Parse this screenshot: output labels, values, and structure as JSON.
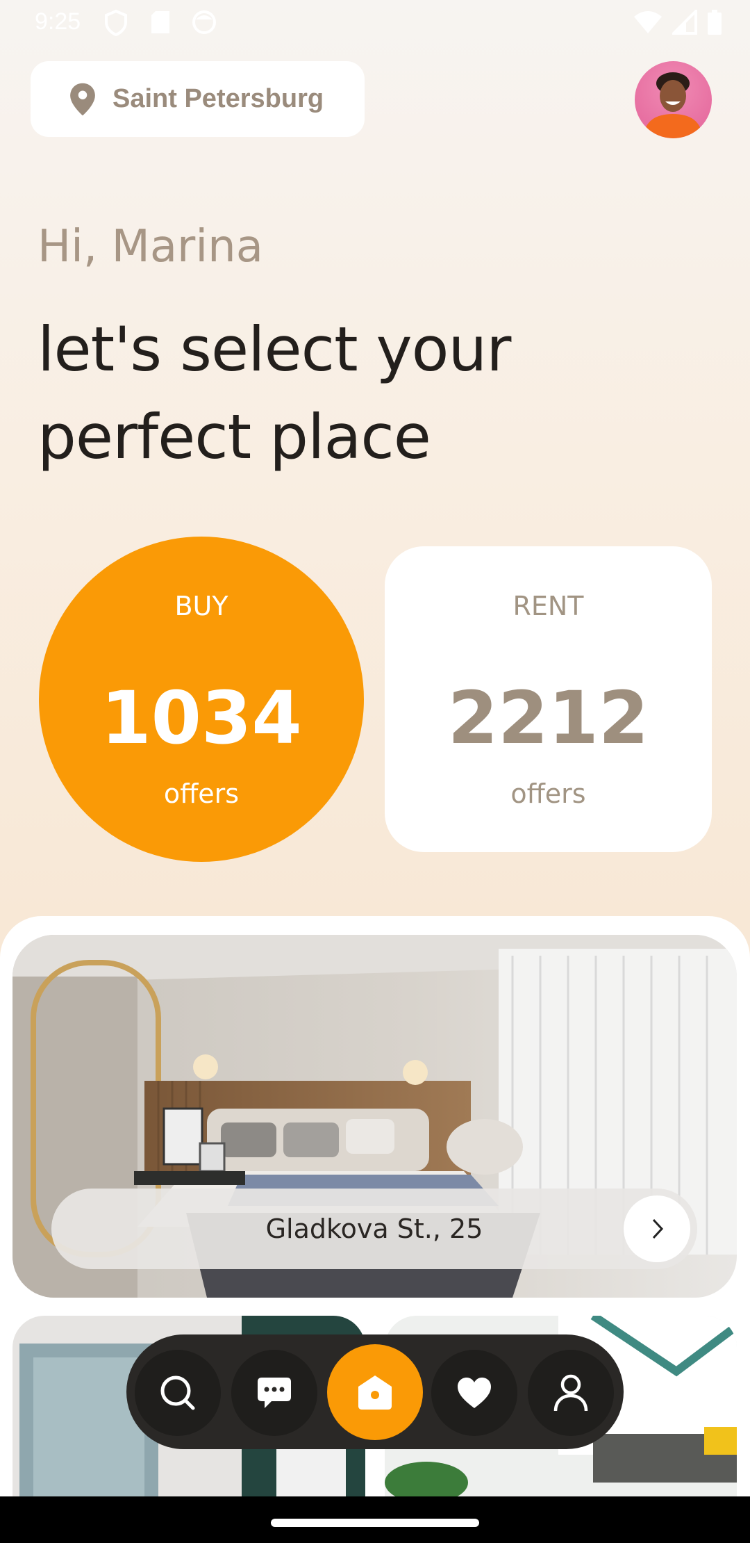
{
  "status_bar": {
    "time": "9:25",
    "left_icons": [
      "shield-icon",
      "sd-card-icon",
      "face-icon"
    ],
    "right_icons": [
      "wifi-icon",
      "signal-icon",
      "battery-icon"
    ]
  },
  "location": {
    "label": "Saint Petersburg",
    "icon": "map-pin-icon"
  },
  "user": {
    "avatar": "user-avatar"
  },
  "greeting": "Hi, Marina",
  "headline": "let's select your perfect place",
  "stats": {
    "buy": {
      "label": "BUY",
      "count": "1034",
      "unit": "offers"
    },
    "rent": {
      "label": "RENT",
      "count": "2212",
      "unit": "offers"
    }
  },
  "listings": {
    "featured": {
      "address": "Gladkova St., 25"
    }
  },
  "bottom_nav": {
    "items": [
      {
        "icon": "search-icon",
        "active": false
      },
      {
        "icon": "chat-icon",
        "active": false
      },
      {
        "icon": "home-icon",
        "active": true
      },
      {
        "icon": "heart-icon",
        "active": false
      },
      {
        "icon": "profile-icon",
        "active": false
      }
    ]
  },
  "colors": {
    "accent": "#fa9a06",
    "background_top": "#f7f4f1",
    "background_bottom": "#f6e4d2",
    "muted_text": "#a79685",
    "dark_text": "#231f1c",
    "nav_bg": "#2a2826"
  }
}
